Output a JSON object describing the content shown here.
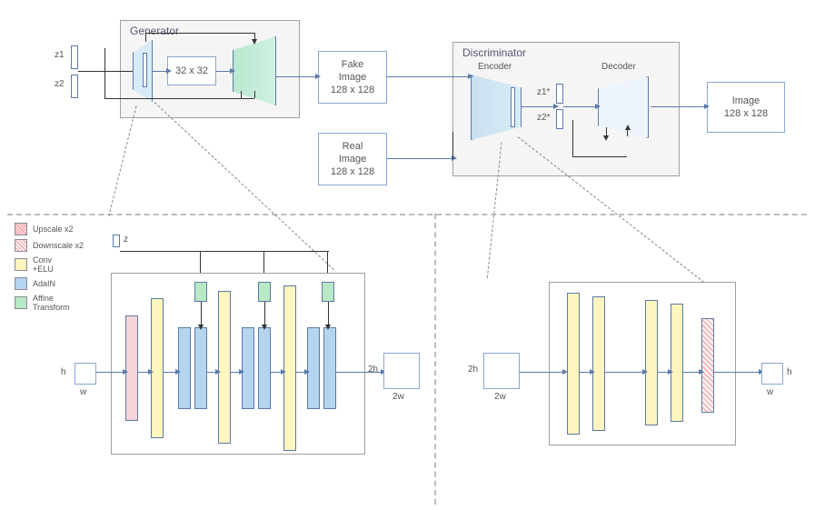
{
  "generator": {
    "label": "Generator",
    "inner_box": "32 x 32",
    "z1": "z1",
    "z2": "z2"
  },
  "fake_image": "Fake\nImage\n128 x 128",
  "real_image": "Real\nImage\n128 x 128",
  "discriminator": {
    "label": "Discriminator",
    "encoder": "Encoder",
    "decoder": "Decoder",
    "z1s": "z1*",
    "z2s": "z2*"
  },
  "output": "Image\n128 x 128",
  "legend": {
    "upscale": "Upscale x2",
    "downscale": "Downscale x2",
    "conv": "Conv\n+ELU",
    "adain": "AdaIN",
    "affine": "Affine\nTransform"
  },
  "gen_block": {
    "z": "z",
    "h": "h",
    "w": "w",
    "h2": "2h",
    "w2": "2w"
  },
  "enc_block": {
    "h2_in": "2h",
    "w2_in": "2w",
    "h_out": "h",
    "w_out": "w"
  },
  "colors": {
    "upscale": "#f7d4d8",
    "downscale": "#f7d4d8",
    "conv": "#fff5bf",
    "adain": "#b5d5ef",
    "affine": "#b8e8c6"
  }
}
